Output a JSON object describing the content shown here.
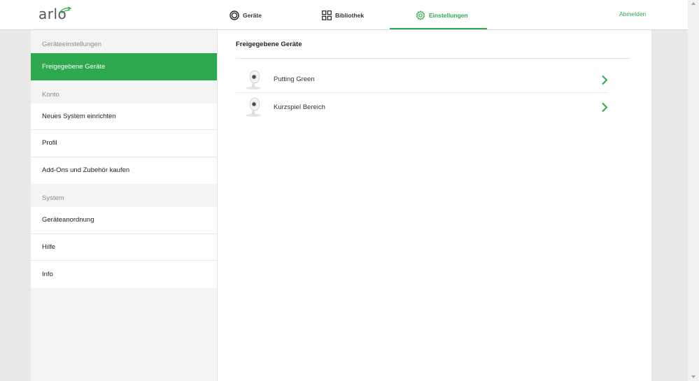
{
  "header": {
    "logo": "arlo",
    "nav": [
      {
        "label": "Geräte",
        "icon": "circle-ring-icon"
      },
      {
        "label": "Bibliothek",
        "icon": "grid-icon"
      },
      {
        "label": "Einstellungen",
        "icon": "gear-icon"
      }
    ],
    "logout": "Abmelden"
  },
  "sidebar": {
    "sections": [
      {
        "title": "Geräteeinstellungen",
        "items": [
          "Freigegebene Geräte"
        ]
      },
      {
        "title": "Konto",
        "items": [
          "Neues System einrichten",
          "Profil",
          "Add-Ons und Zubehör kaufen"
        ]
      },
      {
        "title": "System",
        "items": [
          "Geräteanordnung",
          "Hilfe",
          "Info"
        ]
      }
    ]
  },
  "main": {
    "title": "Freigegebene Geräte",
    "devices": [
      {
        "name": "Putting Green"
      },
      {
        "name": "Kurzspiel Bereich"
      }
    ]
  },
  "colors": {
    "accent": "#2ea84e",
    "background": "#e9e9e9"
  }
}
